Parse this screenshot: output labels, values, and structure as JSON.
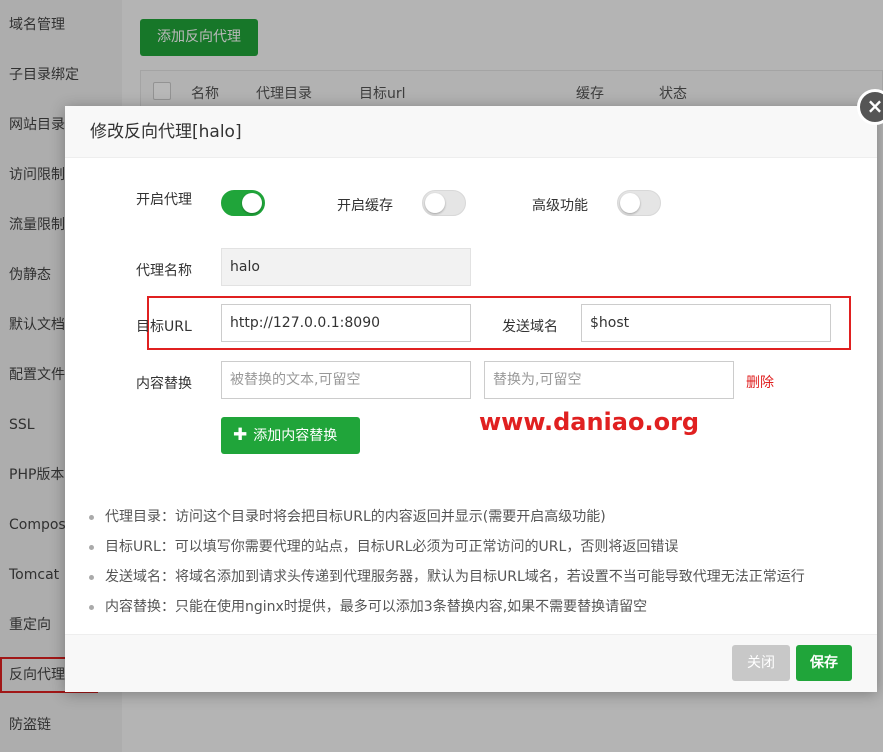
{
  "sidebar": {
    "items": [
      {
        "label": "域名管理"
      },
      {
        "label": "子目录绑定"
      },
      {
        "label": "网站目录"
      },
      {
        "label": "访问限制"
      },
      {
        "label": "流量限制"
      },
      {
        "label": "伪静态"
      },
      {
        "label": "默认文档"
      },
      {
        "label": "配置文件"
      },
      {
        "label": "SSL"
      },
      {
        "label": "PHP版本"
      },
      {
        "label": "Composer"
      },
      {
        "label": "Tomcat"
      },
      {
        "label": "重定向"
      },
      {
        "label": "反向代理"
      },
      {
        "label": "防盗链"
      }
    ],
    "active_index": 13
  },
  "content": {
    "add_button": "添加反向代理",
    "table_headers": [
      "名称",
      "代理目录",
      "目标url",
      "缓存",
      "状态"
    ]
  },
  "modal": {
    "title": "修改反向代理[halo]",
    "enable_proxy_label": "开启代理",
    "enable_proxy": true,
    "enable_cache_label": "开启缓存",
    "enable_cache": false,
    "advanced_label": "高级功能",
    "advanced": false,
    "proxy_name_label": "代理名称",
    "proxy_name_value": "halo",
    "target_url_label": "目标URL",
    "target_url_value": "http://127.0.0.1:8090",
    "send_domain_label": "发送域名",
    "send_domain_value": "$host",
    "replace_label": "内容替换",
    "replace_from_placeholder": "被替换的文本,可留空",
    "replace_to_placeholder": "替换为,可留空",
    "delete_label": "删除",
    "add_replace_button": "添加内容替换",
    "watermark": "www.daniao.org",
    "notes": [
      "代理目录：访问这个目录时将会把目标URL的内容返回并显示(需要开启高级功能)",
      "目标URL：可以填写你需要代理的站点，目标URL必须为可正常访问的URL，否则将返回错误",
      "发送域名：将域名添加到请求头传递到代理服务器，默认为目标URL域名，若设置不当可能导致代理无法正常运行",
      "内容替换：只能在使用nginx时提供，最多可以添加3条替换内容,如果不需要替换请留空"
    ],
    "close_button": "关闭",
    "save_button": "保存"
  },
  "colors": {
    "primary_green": "#20a53a",
    "highlight_red": "#e02020"
  }
}
